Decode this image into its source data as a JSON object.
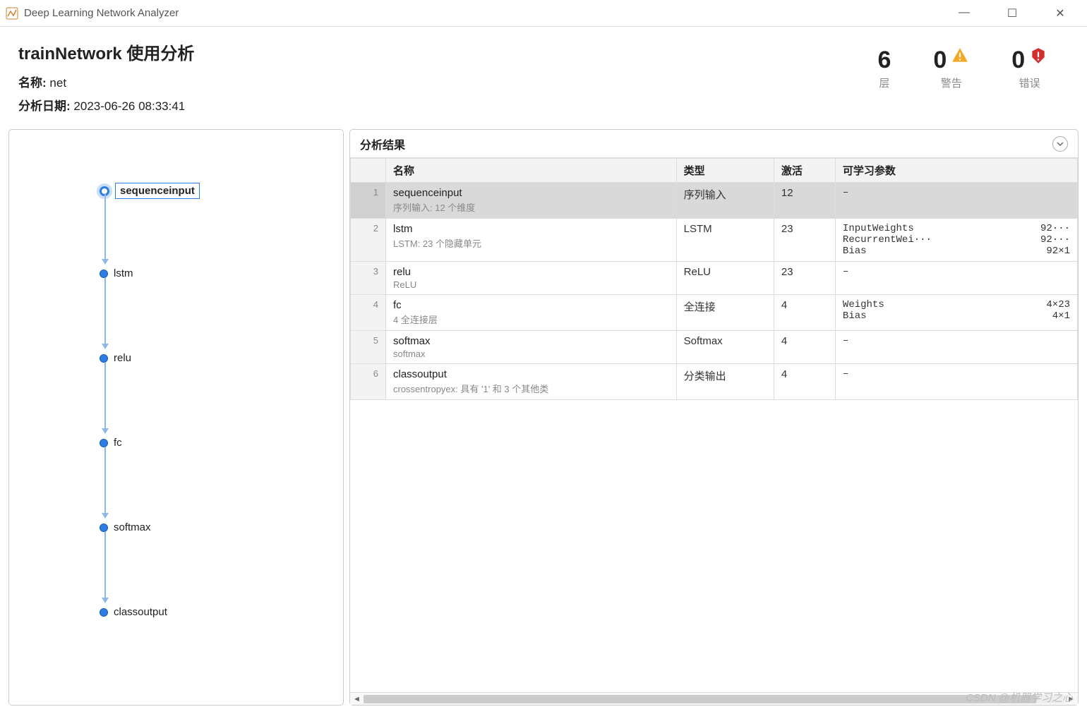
{
  "window": {
    "title": "Deep Learning Network Analyzer"
  },
  "header": {
    "title": "trainNetwork 使用分析",
    "name_label": "名称:",
    "name_value": "net",
    "date_label": "分析日期:",
    "date_value": "2023-06-26 08:33:41"
  },
  "stats": {
    "layers": {
      "value": "6",
      "label": "层"
    },
    "warnings": {
      "value": "0",
      "label": "警告"
    },
    "errors": {
      "value": "0",
      "label": "错误"
    }
  },
  "graph": {
    "nodes": [
      {
        "id": "sequenceinput",
        "label": "sequenceinput",
        "selected": true
      },
      {
        "id": "lstm",
        "label": "lstm",
        "selected": false
      },
      {
        "id": "relu",
        "label": "relu",
        "selected": false
      },
      {
        "id": "fc",
        "label": "fc",
        "selected": false
      },
      {
        "id": "softmax",
        "label": "softmax",
        "selected": false
      },
      {
        "id": "classoutput",
        "label": "classoutput",
        "selected": false
      }
    ]
  },
  "results": {
    "title": "分析结果",
    "columns": {
      "name": "名称",
      "type": "类型",
      "activations": "激活",
      "learnable": "可学习参数"
    },
    "rows": [
      {
        "idx": "1",
        "name": "sequenceinput",
        "sub": "序列输入: 12 个维度",
        "type": "序列输入",
        "activations": "12",
        "learnable": [],
        "dash": "–",
        "selected": true
      },
      {
        "idx": "2",
        "name": "lstm",
        "sub": "LSTM: 23 个隐藏单元",
        "type": "LSTM",
        "activations": "23",
        "learnable": [
          {
            "name": "InputWeights",
            "value": "92···"
          },
          {
            "name": "RecurrentWei···",
            "value": "92···"
          },
          {
            "name": "Bias",
            "value": "92×1"
          }
        ],
        "dash": "",
        "selected": false
      },
      {
        "idx": "3",
        "name": "relu",
        "sub": "ReLU",
        "type": "ReLU",
        "activations": "23",
        "learnable": [],
        "dash": "–",
        "selected": false
      },
      {
        "idx": "4",
        "name": "fc",
        "sub": "4 全连接层",
        "type": "全连接",
        "activations": "4",
        "learnable": [
          {
            "name": "Weights",
            "value": "4×23"
          },
          {
            "name": "Bias",
            "value": "4×1"
          }
        ],
        "dash": "",
        "selected": false
      },
      {
        "idx": "5",
        "name": "softmax",
        "sub": "softmax",
        "type": "Softmax",
        "activations": "4",
        "learnable": [],
        "dash": "–",
        "selected": false
      },
      {
        "idx": "6",
        "name": "classoutput",
        "sub": "crossentropyex: 具有 '1' 和 3 个其他类",
        "type": "分类输出",
        "activations": "4",
        "learnable": [],
        "dash": "–",
        "selected": false
      }
    ]
  },
  "watermark": "CSDN @机器学习之心"
}
